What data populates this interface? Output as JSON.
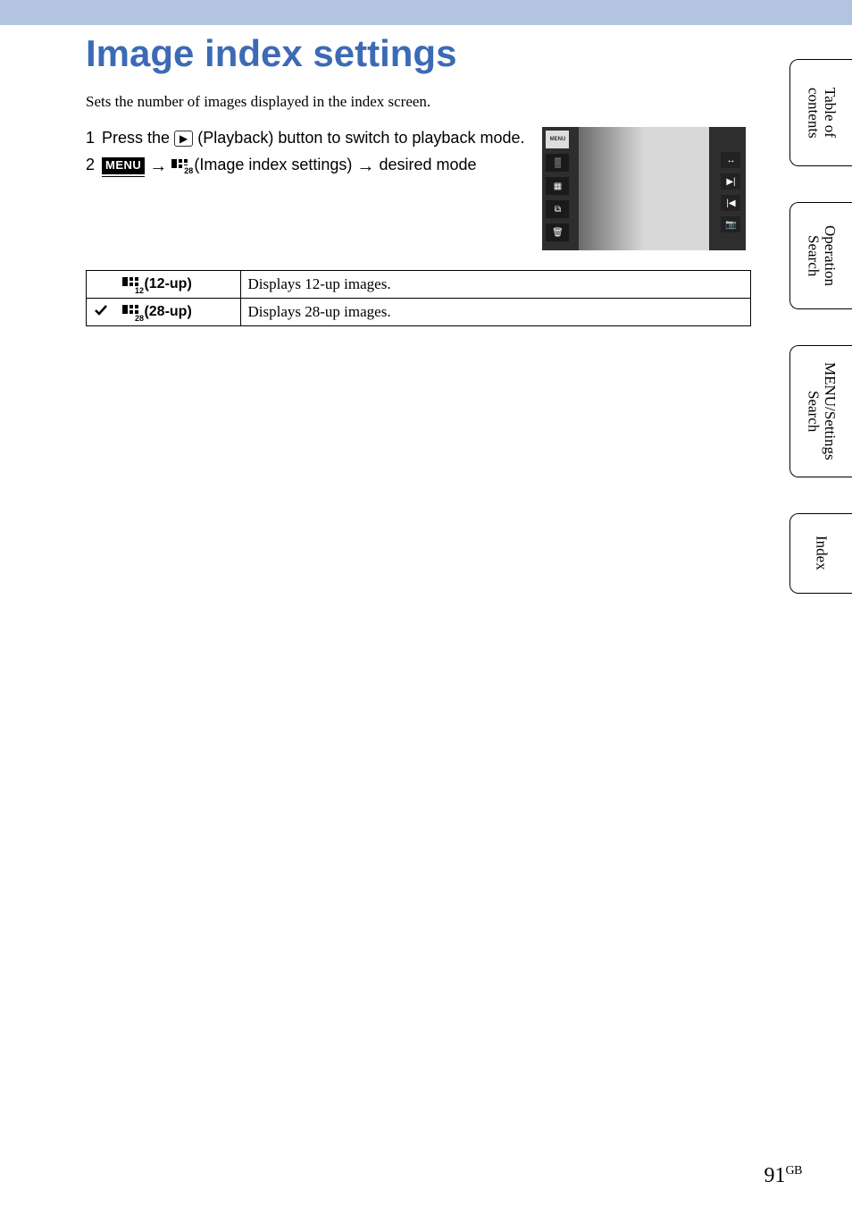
{
  "page": {
    "title": "Image index settings",
    "intro": "Sets the number of images displayed in the index screen.",
    "page_number": "91",
    "page_suffix": "GB"
  },
  "steps": [
    {
      "num": "1",
      "before_icon": "Press the ",
      "icon_label": "▶",
      "after_icon": " (Playback) button to switch to playback mode."
    },
    {
      "num": "2",
      "menu_label": "MENU",
      "arrow": "→",
      "sub": "28",
      "middle": " (Image index settings) ",
      "arrow2": "→",
      "end": " desired mode"
    }
  ],
  "table": {
    "rows": [
      {
        "checked": false,
        "sub": "12",
        "label": " (12-up)",
        "desc": "Displays 12-up images."
      },
      {
        "checked": true,
        "sub": "28",
        "label": " (28-up)",
        "desc": "Displays 28-up images."
      }
    ]
  },
  "side_tabs": [
    {
      "text": "Table of\ncontents",
      "two": true
    },
    {
      "text": "Operation\nSearch",
      "two": true
    },
    {
      "text": "MENU/Settings\nSearch",
      "two": true
    },
    {
      "text": "Index",
      "two": false
    }
  ],
  "screenshot_icons": {
    "left": [
      "MENU",
      "▒",
      "▦",
      "⧉",
      "🗑"
    ],
    "right": [
      "↔",
      "▶|",
      "|◀",
      "📷"
    ]
  }
}
